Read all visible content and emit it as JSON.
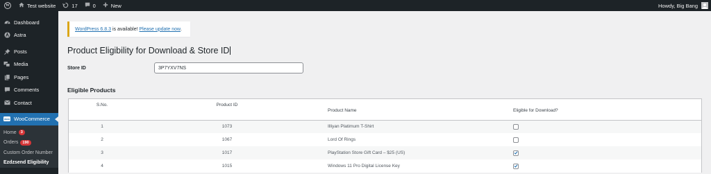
{
  "adminbar": {
    "site_name": "Test website",
    "updates_count": "17",
    "comments_count": "0",
    "new_label": "New",
    "greeting": "Howdy, Big Bang"
  },
  "sidebar": {
    "items": [
      {
        "label": "Dashboard",
        "icon": "dashboard-icon"
      },
      {
        "label": "Astra",
        "icon": "astra-icon"
      },
      {
        "label": "Posts",
        "icon": "pin-icon"
      },
      {
        "label": "Media",
        "icon": "media-icon"
      },
      {
        "label": "Pages",
        "icon": "pages-icon"
      },
      {
        "label": "Comments",
        "icon": "comments-icon"
      },
      {
        "label": "Contact",
        "icon": "mail-icon"
      },
      {
        "label": "WooCommerce",
        "icon": "woo-icon"
      }
    ],
    "submenu": [
      {
        "label": "Home",
        "badge": "3"
      },
      {
        "label": "Orders",
        "badge": "190"
      },
      {
        "label": "Custom Order Number",
        "badge": ""
      },
      {
        "label": "Ezdzsend Eligibility",
        "badge": ""
      }
    ],
    "woo_icon_text": "woo"
  },
  "notice": {
    "version_link": "WordPress 6.8.3",
    "middle_text": " is available! ",
    "update_link": "Please update now",
    "end_text": "."
  },
  "page": {
    "title": "Product Eligibility for Download & Store ID",
    "store_label": "Store ID",
    "store_value": "3P7YXV7NS",
    "section_title": "Eligible Products"
  },
  "table": {
    "headers": {
      "sno": "S.No.",
      "pid": "Product ID",
      "name": "Product Name",
      "eligible": "Eligible for Download?"
    },
    "rows": [
      {
        "sno": "1",
        "pid": "1073",
        "name": "Illiyan Platimum T-Shirt",
        "eligible": false
      },
      {
        "sno": "2",
        "pid": "1067",
        "name": "Lord Of Rings",
        "eligible": false
      },
      {
        "sno": "3",
        "pid": "1017",
        "name": "PlayStation Store Gift Card – $25 (US)",
        "eligible": true
      },
      {
        "sno": "4",
        "pid": "1015",
        "name": "Windows 11 Pro Digital License Key",
        "eligible": true
      }
    ]
  },
  "colors": {
    "accent": "#2271b1",
    "admin_bg": "#1d2327",
    "badge": "#d63638",
    "notice_border": "#dba617"
  }
}
